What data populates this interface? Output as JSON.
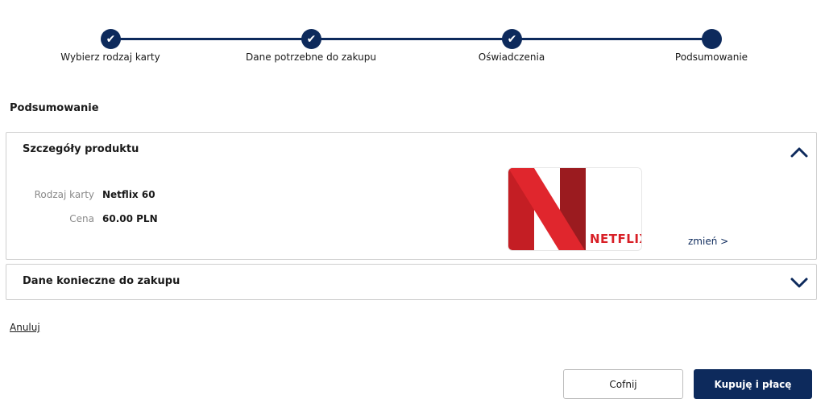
{
  "stepper": {
    "steps": [
      {
        "label": "Wybierz rodzaj karty",
        "status": "done"
      },
      {
        "label": "Dane potrzebne do zakupu",
        "status": "done"
      },
      {
        "label": "Oświadczenia",
        "status": "done"
      },
      {
        "label": "Podsumowanie",
        "status": "current"
      }
    ],
    "done_icon": "check-icon",
    "color": "#0d2a5c"
  },
  "page": {
    "title": "Podsumowanie"
  },
  "product_panel": {
    "title": "Szczegóły produktu",
    "expanded": true,
    "card_type_label": "Rodzaj karty",
    "card_type_value": "Netflix 60",
    "price_label": "Cena",
    "price_value": "60.00 PLN",
    "card_brand_text": "NETFLIX",
    "change_link": "zmień >"
  },
  "purchase_panel": {
    "title": "Dane konieczne do zakupu",
    "expanded": false
  },
  "actions": {
    "cancel_label": "Anuluj",
    "back_label": "Cofnij",
    "buy_label": "Kupuję i płacę"
  },
  "colors": {
    "primary": "#0d2a5c",
    "netflix_red": "#d81f26",
    "netflix_dark_red": "#9b1b1f"
  }
}
